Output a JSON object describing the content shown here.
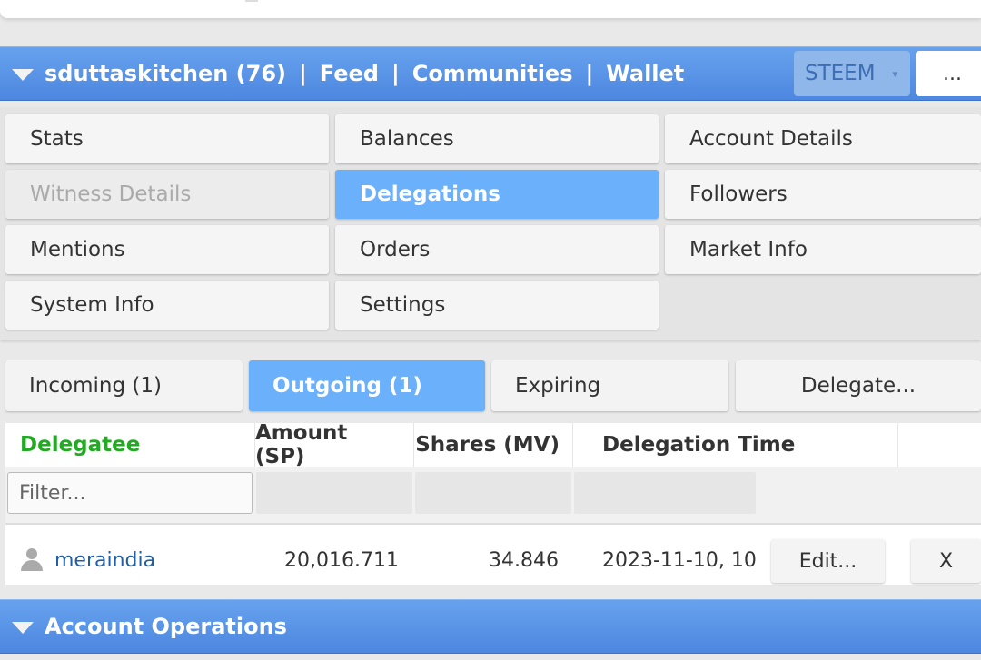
{
  "header": {
    "account": "sduttaskitchen (76)",
    "separator": "|",
    "links": [
      "Feed",
      "Communities",
      "Wallet"
    ],
    "chain_select": "STEEM",
    "chain_caret": "▾",
    "more_label": "..."
  },
  "menu": {
    "items": [
      {
        "label": "Stats"
      },
      {
        "label": "Balances"
      },
      {
        "label": "Account Details"
      },
      {
        "label": "Witness Details"
      },
      {
        "label": "Delegations"
      },
      {
        "label": "Followers"
      },
      {
        "label": "Mentions"
      },
      {
        "label": "Orders"
      },
      {
        "label": "Market Info"
      },
      {
        "label": "System Info"
      },
      {
        "label": "Settings"
      }
    ]
  },
  "tabs": {
    "items": [
      {
        "label": "Incoming (1)"
      },
      {
        "label": "Outgoing (1)"
      },
      {
        "label": "Expiring"
      },
      {
        "label": "Delegate..."
      }
    ]
  },
  "table": {
    "columns": [
      "Delegatee",
      "Amount (SP)",
      "Shares (MV)",
      "Delegation Time"
    ],
    "filter_placeholder": "Filter...",
    "rows": [
      {
        "delegatee": "meraindia",
        "amount": "20,016.711",
        "shares": "34.846",
        "time": "2023-11-10, 10:",
        "edit_label": "Edit...",
        "remove_label": "X"
      }
    ]
  },
  "footer": {
    "title": "Account Operations"
  }
}
